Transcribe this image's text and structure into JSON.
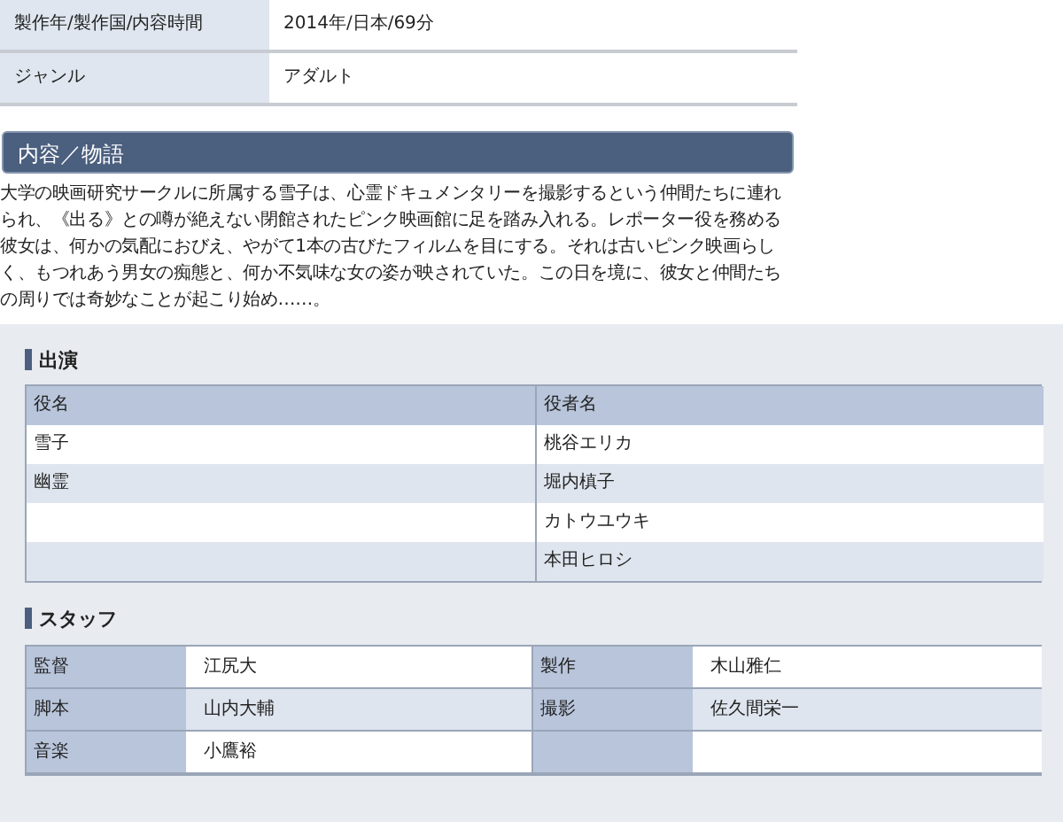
{
  "info_rows": [
    {
      "label": "製作年/製作国/内容時間",
      "value": "2014年/日本/69分"
    },
    {
      "label": "ジャンル",
      "value": "アダルト"
    }
  ],
  "synopsis": {
    "title": "内容／物語",
    "text": "大学の映画研究サークルに所属する雪子は、心霊ドキュメンタリーを撮影するという仲間たちに連れられ、《出る》との噂が絶えない閉館されたピンク映画館に足を踏み入れる。レポーター役を務める彼女は、何かの気配におびえ、やがて1本の古びたフィルムを目にする。それは古いピンク映画らしく、もつれあう男女の痴態と、何か不気味な女の姿が映されていた。この日を境に、彼女と仲間たちの周りでは奇妙なことが起こり始め……。"
  },
  "cast": {
    "title": "出演",
    "columns": [
      "役名",
      "役者名"
    ],
    "rows": [
      {
        "role": "雪子",
        "actor": "桃谷エリカ"
      },
      {
        "role": "幽霊",
        "actor": "堀内槙子"
      },
      {
        "actor": "カトウユウキ"
      },
      {
        "actor": "本田ヒロシ"
      }
    ]
  },
  "staff": {
    "title": "スタッフ",
    "items": [
      {
        "role": "監督",
        "name": "江尻大"
      },
      {
        "role": "製作",
        "name": "木山雅仁"
      },
      {
        "role": "脚本",
        "name": "山内大輔"
      },
      {
        "role": "撮影",
        "name": "佐久間栄一"
      },
      {
        "role": "音楽",
        "name": "小鷹裕"
      }
    ]
  }
}
